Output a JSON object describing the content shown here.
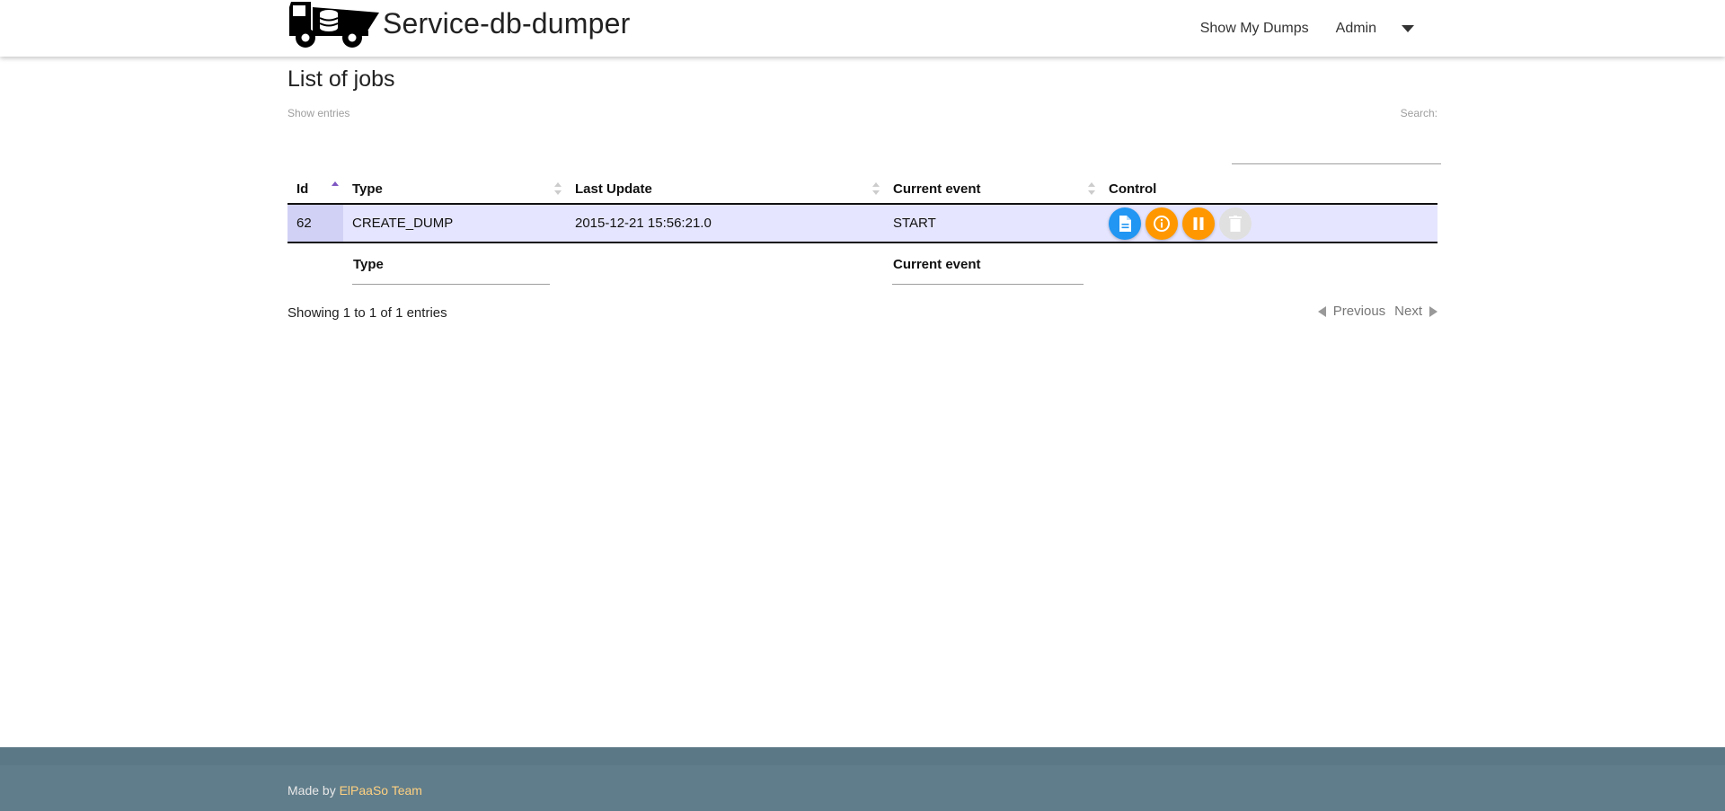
{
  "navbar": {
    "title": "Service-db-dumper",
    "logo_icon": "dump-truck-database-icon",
    "links": [
      {
        "label": "Show My Dumps"
      },
      {
        "label": "Admin"
      }
    ]
  },
  "page": {
    "title": "List of jobs",
    "show_entries_label": "Show entries",
    "search_label": "Search:",
    "search_value": ""
  },
  "table": {
    "columns": [
      {
        "label": "Id",
        "sort": "ascending"
      },
      {
        "label": "Type",
        "sort": "none"
      },
      {
        "label": "Last Update",
        "sort": "none"
      },
      {
        "label": "Current event",
        "sort": "none"
      },
      {
        "label": "Control",
        "sort": null
      }
    ],
    "rows": [
      {
        "id": "62",
        "type": "CREATE_DUMP",
        "last_update": "2015-12-21 15:56:21.0",
        "current_event": "START",
        "controls": [
          "file-icon",
          "info-icon",
          "pause-icon",
          "delete-icon"
        ]
      }
    ],
    "filters": [
      {
        "label": "Type"
      },
      {
        "label": "Current event"
      }
    ]
  },
  "pagination": {
    "summary": "Showing 1 to 1 of 1 entries",
    "previous_label": "Previous",
    "next_label": "Next"
  },
  "footer": {
    "prefix": "Made by ",
    "link_label": "ElPaaSo Team"
  },
  "colors": {
    "navbar_bg": "#ffffff",
    "footer_bg": "#607d8b",
    "footer_link": "#ffd180",
    "row_bg": "#e5e5ff",
    "sorted_cell_bg": "#d1d1f5",
    "btn_blue": "#2196f3",
    "btn_orange": "#ff9800",
    "btn_disabled": "#e0e0e0",
    "sort_active": "#7e57c2"
  }
}
